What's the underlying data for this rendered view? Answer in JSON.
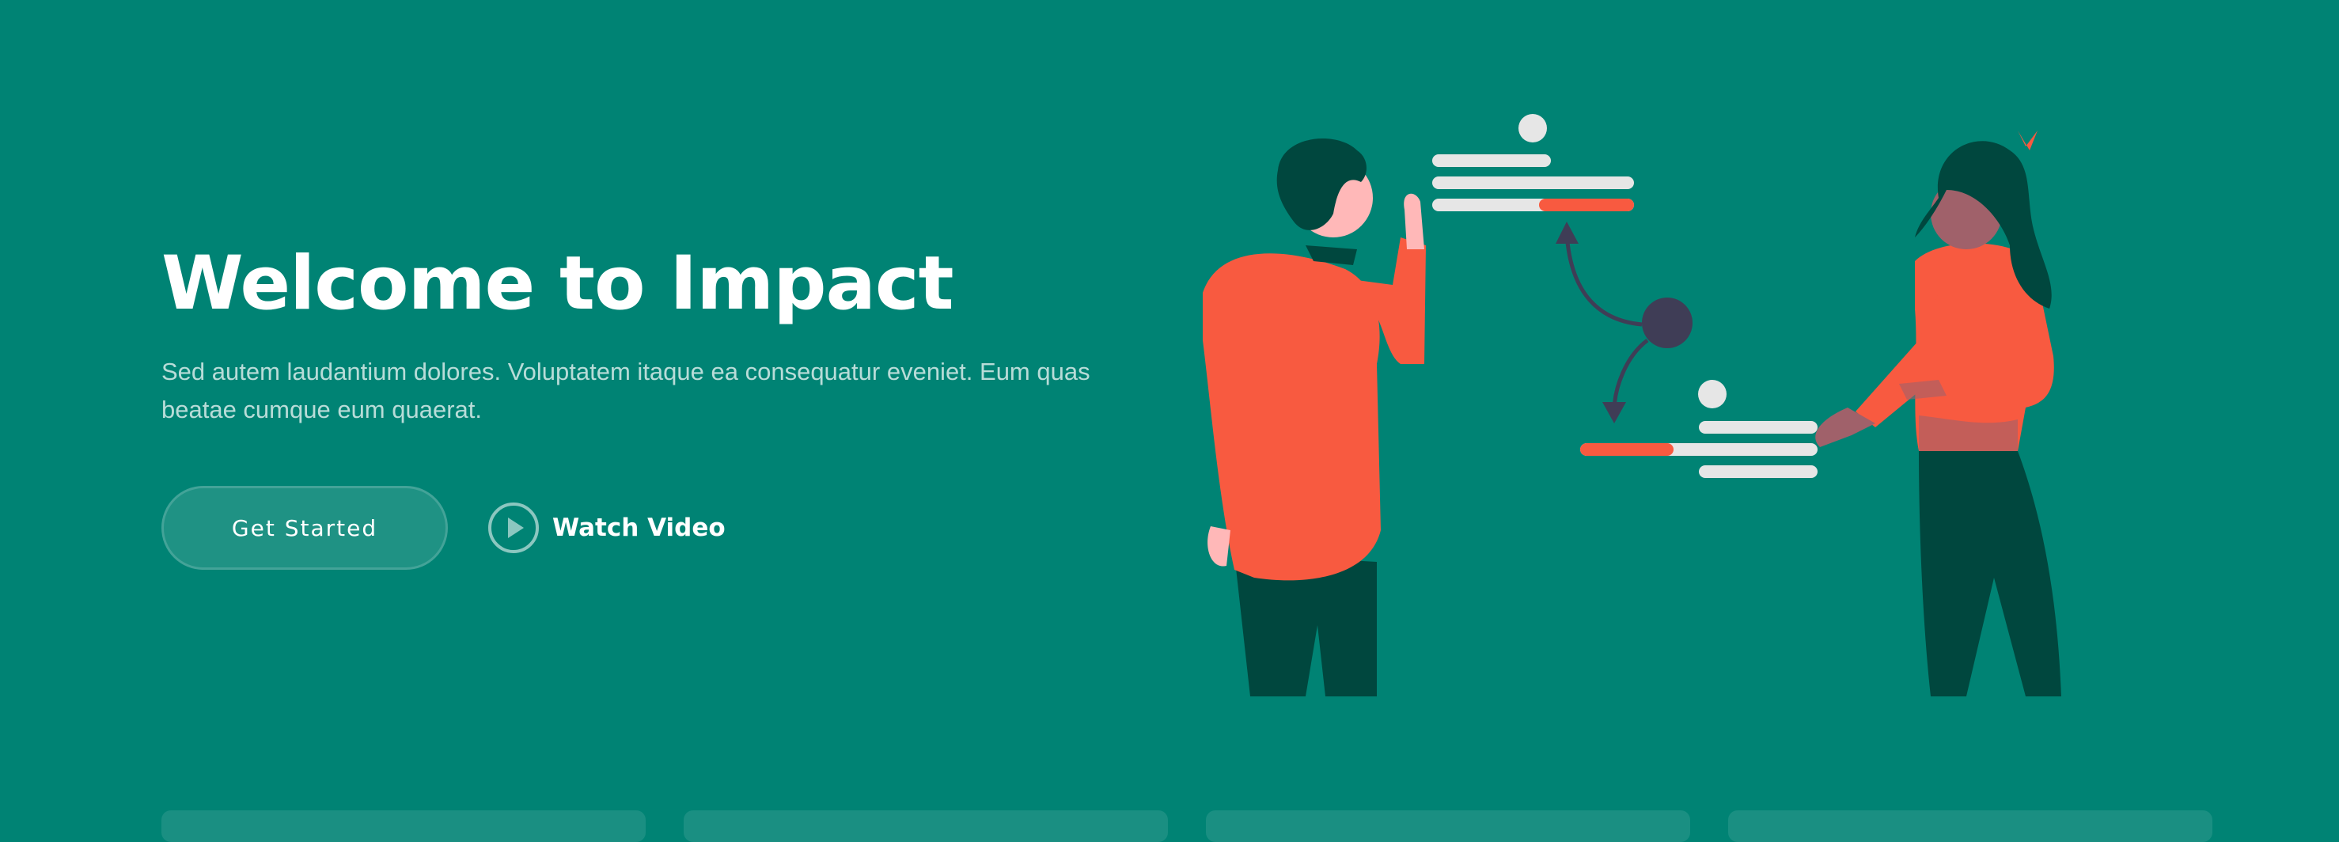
{
  "hero": {
    "title": "Welcome to Impact",
    "subtitle": "Sed autem laudantium dolores. Voluptatem itaque ea consequatur eveniet. Eum quas beatae cumque eum quaerat.",
    "get_started_label": "Get Started",
    "watch_video_label": "Watch Video"
  },
  "colors": {
    "background": "#008374",
    "accent": "#F85A40",
    "dark_green": "#00473E",
    "light_bar": "#E6E6E6",
    "dark_node": "#3F3D56",
    "skin": "#FFB8B8"
  },
  "icons": {
    "play": "play-circle-icon"
  },
  "illustration": {
    "name": "team-discussion-illustration"
  },
  "cards": [
    {
      "name": "feature-card-1"
    },
    {
      "name": "feature-card-2"
    },
    {
      "name": "feature-card-3"
    },
    {
      "name": "feature-card-4"
    }
  ]
}
